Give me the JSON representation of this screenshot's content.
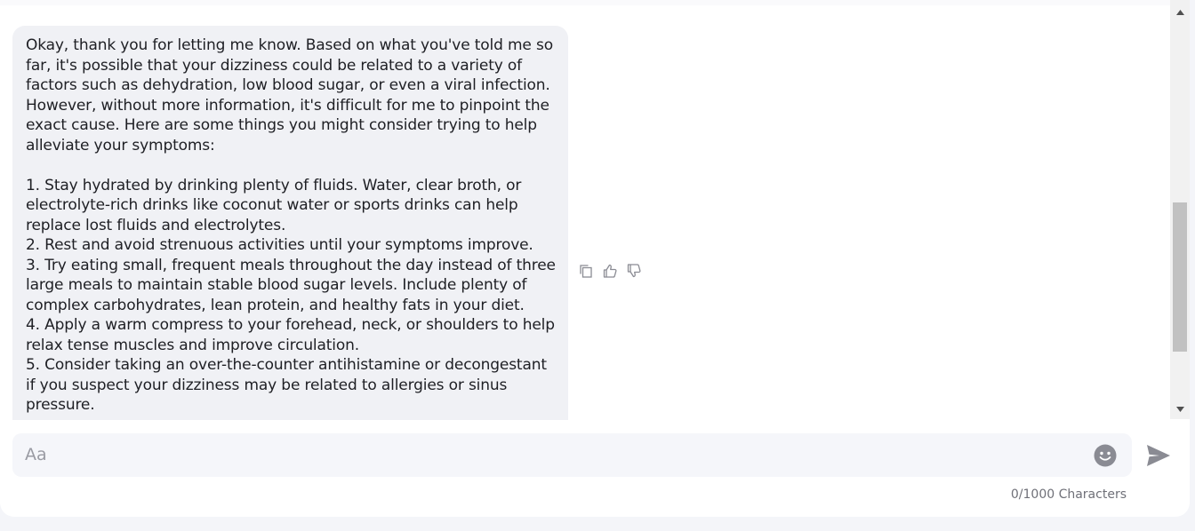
{
  "chat": {
    "messages": [
      {
        "role": "assistant",
        "text": "Okay, thank you for letting me know. Based on what you've told me so far, it's possible that your dizziness could be related to a variety of factors such as dehydration, low blood sugar, or even a viral infection. However, without more information, it's difficult for me to pinpoint the exact cause. Here are some things you might consider trying to help alleviate your symptoms:\n\n1. Stay hydrated by drinking plenty of fluids. Water, clear broth, or electrolyte-rich drinks like coconut water or sports drinks can help replace lost fluids and electrolytes.\n2. Rest and avoid strenuous activities until your symptoms improve.\n3. Try eating small, frequent meals throughout the day instead of three large meals to maintain stable blood sugar levels. Include plenty of complex carbohydrates, lean protein, and healthy fats in your diet.\n4. Apply a warm compress to your forehead, neck, or shoulders to help relax tense muscles and improve circulation.\n5. Consider taking an over-the-counter antihistamine or decongestant if you suspect your dizziness may be related to allergies or sinus pressure."
      }
    ],
    "message_actions": {
      "copy_icon": "copy-icon",
      "like_icon": "thumbs-up-icon",
      "dislike_icon": "thumbs-down-icon"
    }
  },
  "composer": {
    "value": "",
    "placeholder": "Aa",
    "emoji_icon": "emoji-icon",
    "send_icon": "send-icon",
    "char_counter": "0/1000 Characters"
  },
  "colors": {
    "bubble_bg": "#f0f1f5",
    "composer_bg": "#f5f6fa",
    "icon_gray": "#8a8b93"
  }
}
